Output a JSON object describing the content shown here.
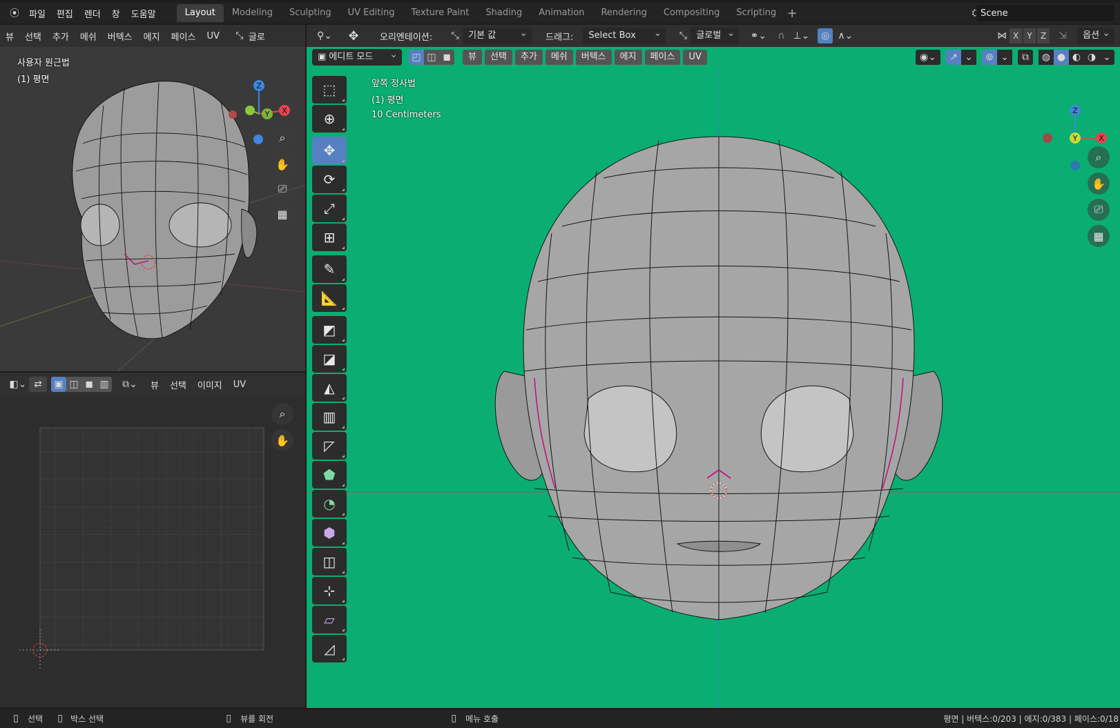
{
  "menubar": {
    "items": [
      "파일",
      "편집",
      "렌더",
      "창",
      "도움말"
    ],
    "workspaces": [
      "Layout",
      "Modeling",
      "Sculpting",
      "UV Editing",
      "Texture Paint",
      "Shading",
      "Animation",
      "Rendering",
      "Compositing",
      "Scripting"
    ],
    "active_workspace": "Layout",
    "scene_name": "Scene"
  },
  "left_viewport": {
    "header_items": [
      "뷰",
      "선택",
      "추가",
      "메쉬",
      "버텍스",
      "에지",
      "페이스",
      "UV"
    ],
    "header_trailing": "글로",
    "view_name": "사용자 원근법",
    "object_name": "(1) 평면"
  },
  "uv_editor": {
    "header_items": [
      "뷰",
      "선택",
      "이미지",
      "UV"
    ]
  },
  "main_viewport": {
    "orientation_label": "오리엔테이션:",
    "orientation_value": "기본 값",
    "drag_label": "드래그:",
    "drag_value": "Select Box",
    "transform_space": "글로벌",
    "options_label": "옵션",
    "axis_buttons": [
      "X",
      "Y",
      "Z"
    ],
    "mode": "에디트 모드",
    "header_items": [
      "뷰",
      "선택",
      "추가",
      "메쉬",
      "버텍스",
      "에지",
      "페이스",
      "UV"
    ],
    "view_name": "앞쪽 정사법",
    "object_name": "(1) 평면",
    "grid_scale": "10 Centimeters",
    "background_color": "#0aae73"
  },
  "gizmo_labels": {
    "z": "Z",
    "y": "Y",
    "x": "X"
  },
  "statusbar": {
    "select": "선택",
    "box_select": "박스 선택",
    "rotate_view": "뷰를 회전",
    "call_menu": "메뉴 호출",
    "stats": "평면 | 버텍스:0/203 | 에지:0/383 | 페이스:0/18"
  },
  "colors": {
    "accent": "#5680c2",
    "axis_x": "#e8424f",
    "axis_y": "#8cc63f",
    "axis_z": "#3f86de"
  }
}
